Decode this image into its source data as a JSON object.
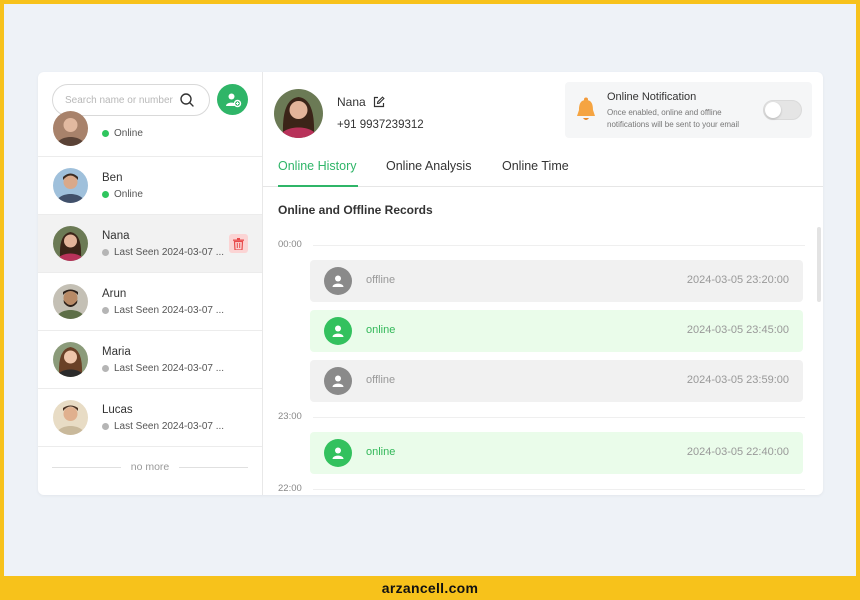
{
  "search": {
    "placeholder": "Search name or number"
  },
  "contacts": [
    {
      "name": "",
      "status": "Online",
      "online": true
    },
    {
      "name": "Ben",
      "status": "Online",
      "online": true
    },
    {
      "name": "Nana",
      "status": "Last Seen 2024-03-07 ...",
      "online": false
    },
    {
      "name": "Arun",
      "status": "Last Seen 2024-03-07 ...",
      "online": false
    },
    {
      "name": "Maria",
      "status": "Last Seen 2024-03-07 ...",
      "online": false
    },
    {
      "name": "Lucas",
      "status": "Last Seen 2024-03-07 ...",
      "online": false
    }
  ],
  "no_more": "no more",
  "profile": {
    "name": "Nana",
    "phone": "+91 9937239312"
  },
  "notification": {
    "title": "Online Notification",
    "description": "Once enabled, online and offline notifications will be sent to your email",
    "enabled": false
  },
  "tabs": [
    "Online History",
    "Online Analysis",
    "Online Time"
  ],
  "active_tab": "Online History",
  "section_title": "Online and Offline Records",
  "time_labels": [
    "00:00",
    "23:00",
    "22:00"
  ],
  "records": [
    {
      "status": "offline",
      "time": "2024-03-05 23:20:00"
    },
    {
      "status": "online",
      "time": "2024-03-05 23:45:00"
    },
    {
      "status": "offline",
      "time": "2024-03-05 23:59:00"
    },
    {
      "status": "online",
      "time": "2024-03-05 22:40:00"
    }
  ],
  "colors": {
    "accent": "#2fb568",
    "online_dot": "#2fc55e",
    "offline_dot": "#b5b5b5",
    "delete": "#e84b4b",
    "bell": "#f29a3a",
    "banner": "#f7c21b"
  },
  "footer": "arzancell.com"
}
